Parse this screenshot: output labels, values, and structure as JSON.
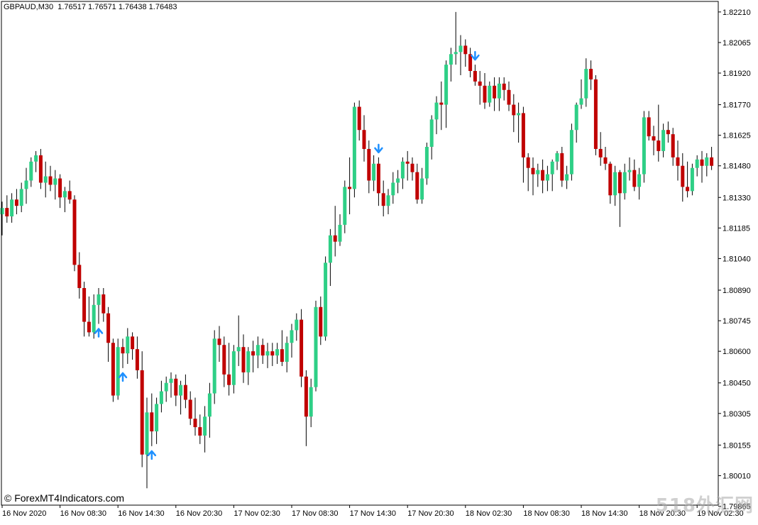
{
  "header": {
    "symbol": "GBPAUD,M30",
    "ohlc": "1.76517 1.76571 1.76438 1.76483"
  },
  "watermark": "© ForexMT4Indicators.com",
  "corner_watermark": "518外汇网",
  "colors": {
    "bull": "#2ecf86",
    "bear": "#c00000",
    "wick": "#000000",
    "arrow": "#1e90ff",
    "background": "#ffffff",
    "axis": "#000000"
  },
  "chart_data": {
    "type": "candlestick",
    "title": "",
    "xlabel": "",
    "ylabel": "",
    "ylim": [
      1.7987,
      1.8226
    ],
    "y_ticks": [
      "1.82210",
      "1.82065",
      "1.81920",
      "1.81770",
      "1.81625",
      "1.81480",
      "1.81330",
      "1.81185",
      "1.81040",
      "1.80890",
      "1.80745",
      "1.80600",
      "1.80450",
      "1.80305",
      "1.80155",
      "1.80010",
      "1.79865"
    ],
    "x_ticks": [
      "16 Nov 2020",
      "16 Nov 08:30",
      "16 Nov 14:30",
      "16 Nov 20:30",
      "17 Nov 02:30",
      "17 Nov 08:30",
      "17 Nov 14:30",
      "17 Nov 20:30",
      "18 Nov 02:30",
      "18 Nov 08:30",
      "18 Nov 14:30",
      "18 Nov 20:30",
      "19 Nov 02:30"
    ],
    "x_tick_candle_index": [
      0,
      12,
      24,
      36,
      48,
      60,
      72,
      84,
      96,
      108,
      120,
      132,
      144
    ],
    "candles": [
      {
        "o": 1.8125,
        "h": 1.8131,
        "l": 1.8115,
        "c": 1.8128
      },
      {
        "o": 1.8128,
        "h": 1.8134,
        "l": 1.8121,
        "c": 1.8124
      },
      {
        "o": 1.8124,
        "h": 1.8135,
        "l": 1.8121,
        "c": 1.8132
      },
      {
        "o": 1.8132,
        "h": 1.8137,
        "l": 1.8125,
        "c": 1.8129
      },
      {
        "o": 1.8129,
        "h": 1.814,
        "l": 1.8126,
        "c": 1.8137
      },
      {
        "o": 1.8137,
        "h": 1.8147,
        "l": 1.813,
        "c": 1.8141
      },
      {
        "o": 1.8141,
        "h": 1.8152,
        "l": 1.8138,
        "c": 1.815
      },
      {
        "o": 1.815,
        "h": 1.8155,
        "l": 1.8145,
        "c": 1.8153
      },
      {
        "o": 1.8153,
        "h": 1.8156,
        "l": 1.8137,
        "c": 1.814
      },
      {
        "o": 1.814,
        "h": 1.815,
        "l": 1.8133,
        "c": 1.8143
      },
      {
        "o": 1.8143,
        "h": 1.8148,
        "l": 1.8136,
        "c": 1.8139
      },
      {
        "o": 1.8139,
        "h": 1.8146,
        "l": 1.8132,
        "c": 1.8142
      },
      {
        "o": 1.8142,
        "h": 1.8144,
        "l": 1.8128,
        "c": 1.8133
      },
      {
        "o": 1.8133,
        "h": 1.8138,
        "l": 1.8126,
        "c": 1.8136
      },
      {
        "o": 1.8136,
        "h": 1.8141,
        "l": 1.813,
        "c": 1.8132
      },
      {
        "o": 1.8132,
        "h": 1.8134,
        "l": 1.8098,
        "c": 1.8101
      },
      {
        "o": 1.8101,
        "h": 1.8107,
        "l": 1.8085,
        "c": 1.809
      },
      {
        "o": 1.809,
        "h": 1.8093,
        "l": 1.8067,
        "c": 1.8074
      },
      {
        "o": 1.8074,
        "h": 1.8086,
        "l": 1.8067,
        "c": 1.8069
      },
      {
        "o": 1.8069,
        "h": 1.8087,
        "l": 1.8066,
        "c": 1.8082
      },
      {
        "o": 1.8082,
        "h": 1.809,
        "l": 1.8073,
        "c": 1.8087
      },
      {
        "o": 1.8087,
        "h": 1.809,
        "l": 1.8074,
        "c": 1.8078
      },
      {
        "o": 1.8078,
        "h": 1.8081,
        "l": 1.8055,
        "c": 1.8064
      },
      {
        "o": 1.8064,
        "h": 1.8066,
        "l": 1.8036,
        "c": 1.8039
      },
      {
        "o": 1.8039,
        "h": 1.8066,
        "l": 1.8037,
        "c": 1.8062
      },
      {
        "o": 1.8062,
        "h": 1.8066,
        "l": 1.8052,
        "c": 1.8059
      },
      {
        "o": 1.8059,
        "h": 1.8071,
        "l": 1.8054,
        "c": 1.8067
      },
      {
        "o": 1.8067,
        "h": 1.8069,
        "l": 1.8056,
        "c": 1.8061
      },
      {
        "o": 1.8061,
        "h": 1.8067,
        "l": 1.8047,
        "c": 1.8051
      },
      {
        "o": 1.8051,
        "h": 1.806,
        "l": 1.8005,
        "c": 1.8011
      },
      {
        "o": 1.8011,
        "h": 1.8038,
        "l": 1.7995,
        "c": 1.8031
      },
      {
        "o": 1.8031,
        "h": 1.804,
        "l": 1.8015,
        "c": 1.8022
      },
      {
        "o": 1.8022,
        "h": 1.8038,
        "l": 1.8016,
        "c": 1.8035
      },
      {
        "o": 1.8035,
        "h": 1.8046,
        "l": 1.8031,
        "c": 1.8041
      },
      {
        "o": 1.8041,
        "h": 1.8048,
        "l": 1.8036,
        "c": 1.8045
      },
      {
        "o": 1.8045,
        "h": 1.805,
        "l": 1.8038,
        "c": 1.8047
      },
      {
        "o": 1.8047,
        "h": 1.8049,
        "l": 1.8034,
        "c": 1.8039
      },
      {
        "o": 1.8039,
        "h": 1.8046,
        "l": 1.803,
        "c": 1.8044
      },
      {
        "o": 1.8044,
        "h": 1.8049,
        "l": 1.8033,
        "c": 1.8037
      },
      {
        "o": 1.8037,
        "h": 1.8041,
        "l": 1.8025,
        "c": 1.8028
      },
      {
        "o": 1.8028,
        "h": 1.8038,
        "l": 1.802,
        "c": 1.8024
      },
      {
        "o": 1.8024,
        "h": 1.803,
        "l": 1.8016,
        "c": 1.802
      },
      {
        "o": 1.802,
        "h": 1.8034,
        "l": 1.8012,
        "c": 1.8029
      },
      {
        "o": 1.8029,
        "h": 1.8045,
        "l": 1.8019,
        "c": 1.804
      },
      {
        "o": 1.804,
        "h": 1.807,
        "l": 1.8035,
        "c": 1.8066
      },
      {
        "o": 1.8066,
        "h": 1.8072,
        "l": 1.8055,
        "c": 1.8063
      },
      {
        "o": 1.8063,
        "h": 1.8067,
        "l": 1.8043,
        "c": 1.8049
      },
      {
        "o": 1.8049,
        "h": 1.8064,
        "l": 1.8039,
        "c": 1.8044
      },
      {
        "o": 1.8044,
        "h": 1.8063,
        "l": 1.804,
        "c": 1.806
      },
      {
        "o": 1.806,
        "h": 1.8077,
        "l": 1.8053,
        "c": 1.8062
      },
      {
        "o": 1.8062,
        "h": 1.8068,
        "l": 1.8045,
        "c": 1.805
      },
      {
        "o": 1.805,
        "h": 1.8062,
        "l": 1.8044,
        "c": 1.806
      },
      {
        "o": 1.806,
        "h": 1.8065,
        "l": 1.805,
        "c": 1.8058
      },
      {
        "o": 1.8058,
        "h": 1.8067,
        "l": 1.8052,
        "c": 1.8063
      },
      {
        "o": 1.8063,
        "h": 1.8066,
        "l": 1.8054,
        "c": 1.8058
      },
      {
        "o": 1.8058,
        "h": 1.8064,
        "l": 1.8052,
        "c": 1.806
      },
      {
        "o": 1.806,
        "h": 1.8064,
        "l": 1.8053,
        "c": 1.8058
      },
      {
        "o": 1.8058,
        "h": 1.8064,
        "l": 1.8054,
        "c": 1.8061
      },
      {
        "o": 1.8061,
        "h": 1.807,
        "l": 1.8053,
        "c": 1.8055
      },
      {
        "o": 1.8055,
        "h": 1.8067,
        "l": 1.805,
        "c": 1.8064
      },
      {
        "o": 1.8064,
        "h": 1.8073,
        "l": 1.8057,
        "c": 1.807
      },
      {
        "o": 1.807,
        "h": 1.8078,
        "l": 1.8065,
        "c": 1.8075
      },
      {
        "o": 1.8075,
        "h": 1.808,
        "l": 1.8043,
        "c": 1.8048
      },
      {
        "o": 1.8048,
        "h": 1.8051,
        "l": 1.8015,
        "c": 1.8029
      },
      {
        "o": 1.8029,
        "h": 1.8047,
        "l": 1.8024,
        "c": 1.8043
      },
      {
        "o": 1.8043,
        "h": 1.8084,
        "l": 1.8041,
        "c": 1.8081
      },
      {
        "o": 1.8081,
        "h": 1.8086,
        "l": 1.8063,
        "c": 1.8067
      },
      {
        "o": 1.8067,
        "h": 1.8105,
        "l": 1.8065,
        "c": 1.8102
      },
      {
        "o": 1.8102,
        "h": 1.8118,
        "l": 1.8091,
        "c": 1.8115
      },
      {
        "o": 1.8115,
        "h": 1.8129,
        "l": 1.8105,
        "c": 1.8112
      },
      {
        "o": 1.8112,
        "h": 1.8125,
        "l": 1.811,
        "c": 1.812
      },
      {
        "o": 1.812,
        "h": 1.8141,
        "l": 1.8116,
        "c": 1.8138
      },
      {
        "o": 1.8138,
        "h": 1.8152,
        "l": 1.8125,
        "c": 1.8137
      },
      {
        "o": 1.8137,
        "h": 1.8178,
        "l": 1.8133,
        "c": 1.8176
      },
      {
        "o": 1.8176,
        "h": 1.8179,
        "l": 1.816,
        "c": 1.8165
      },
      {
        "o": 1.8165,
        "h": 1.8172,
        "l": 1.815,
        "c": 1.8156
      },
      {
        "o": 1.8156,
        "h": 1.816,
        "l": 1.8135,
        "c": 1.8141
      },
      {
        "o": 1.8141,
        "h": 1.8153,
        "l": 1.8136,
        "c": 1.8149
      },
      {
        "o": 1.8149,
        "h": 1.8152,
        "l": 1.8129,
        "c": 1.8135
      },
      {
        "o": 1.8135,
        "h": 1.8141,
        "l": 1.8124,
        "c": 1.8129
      },
      {
        "o": 1.8129,
        "h": 1.8137,
        "l": 1.8125,
        "c": 1.8134
      },
      {
        "o": 1.8134,
        "h": 1.8145,
        "l": 1.813,
        "c": 1.814
      },
      {
        "o": 1.814,
        "h": 1.8146,
        "l": 1.8135,
        "c": 1.8142
      },
      {
        "o": 1.8142,
        "h": 1.8152,
        "l": 1.8137,
        "c": 1.815
      },
      {
        "o": 1.815,
        "h": 1.8155,
        "l": 1.8141,
        "c": 1.8149
      },
      {
        "o": 1.8149,
        "h": 1.8152,
        "l": 1.8141,
        "c": 1.8145
      },
      {
        "o": 1.8145,
        "h": 1.8149,
        "l": 1.813,
        "c": 1.8132
      },
      {
        "o": 1.8132,
        "h": 1.8147,
        "l": 1.813,
        "c": 1.8142
      },
      {
        "o": 1.8142,
        "h": 1.8159,
        "l": 1.8139,
        "c": 1.8157
      },
      {
        "o": 1.8157,
        "h": 1.8172,
        "l": 1.8151,
        "c": 1.817
      },
      {
        "o": 1.817,
        "h": 1.8181,
        "l": 1.8163,
        "c": 1.8178
      },
      {
        "o": 1.8178,
        "h": 1.8188,
        "l": 1.8165,
        "c": 1.8177
      },
      {
        "o": 1.8177,
        "h": 1.8198,
        "l": 1.8166,
        "c": 1.8196
      },
      {
        "o": 1.8196,
        "h": 1.8204,
        "l": 1.8188,
        "c": 1.8201
      },
      {
        "o": 1.8201,
        "h": 1.8221,
        "l": 1.8196,
        "c": 1.8202
      },
      {
        "o": 1.8202,
        "h": 1.821,
        "l": 1.8191,
        "c": 1.8205
      },
      {
        "o": 1.8205,
        "h": 1.8208,
        "l": 1.8195,
        "c": 1.8201
      },
      {
        "o": 1.8201,
        "h": 1.8204,
        "l": 1.819,
        "c": 1.8193
      },
      {
        "o": 1.8193,
        "h": 1.8196,
        "l": 1.8186,
        "c": 1.8188
      },
      {
        "o": 1.8188,
        "h": 1.8193,
        "l": 1.8177,
        "c": 1.8186
      },
      {
        "o": 1.8186,
        "h": 1.8192,
        "l": 1.8175,
        "c": 1.8178
      },
      {
        "o": 1.8178,
        "h": 1.8188,
        "l": 1.8176,
        "c": 1.8186
      },
      {
        "o": 1.8186,
        "h": 1.819,
        "l": 1.8174,
        "c": 1.818
      },
      {
        "o": 1.818,
        "h": 1.819,
        "l": 1.8174,
        "c": 1.8187
      },
      {
        "o": 1.8187,
        "h": 1.819,
        "l": 1.8179,
        "c": 1.8184
      },
      {
        "o": 1.8184,
        "h": 1.8188,
        "l": 1.8174,
        "c": 1.8177
      },
      {
        "o": 1.8177,
        "h": 1.8182,
        "l": 1.8164,
        "c": 1.8172
      },
      {
        "o": 1.8172,
        "h": 1.8178,
        "l": 1.8159,
        "c": 1.8173
      },
      {
        "o": 1.8173,
        "h": 1.8176,
        "l": 1.814,
        "c": 1.8152
      },
      {
        "o": 1.8152,
        "h": 1.8154,
        "l": 1.8136,
        "c": 1.8147
      },
      {
        "o": 1.8147,
        "h": 1.8152,
        "l": 1.8134,
        "c": 1.8144
      },
      {
        "o": 1.8144,
        "h": 1.8149,
        "l": 1.8138,
        "c": 1.8146
      },
      {
        "o": 1.8146,
        "h": 1.8151,
        "l": 1.8135,
        "c": 1.8141
      },
      {
        "o": 1.8141,
        "h": 1.8148,
        "l": 1.8136,
        "c": 1.8144
      },
      {
        "o": 1.8144,
        "h": 1.8151,
        "l": 1.8136,
        "c": 1.815
      },
      {
        "o": 1.815,
        "h": 1.8155,
        "l": 1.8146,
        "c": 1.8154
      },
      {
        "o": 1.8154,
        "h": 1.8157,
        "l": 1.8138,
        "c": 1.8141
      },
      {
        "o": 1.8141,
        "h": 1.8148,
        "l": 1.8137,
        "c": 1.8144
      },
      {
        "o": 1.8144,
        "h": 1.8168,
        "l": 1.8141,
        "c": 1.8165
      },
      {
        "o": 1.8165,
        "h": 1.8178,
        "l": 1.8159,
        "c": 1.8177
      },
      {
        "o": 1.8177,
        "h": 1.8189,
        "l": 1.8175,
        "c": 1.818
      },
      {
        "o": 1.818,
        "h": 1.8199,
        "l": 1.8176,
        "c": 1.8194
      },
      {
        "o": 1.8194,
        "h": 1.8198,
        "l": 1.8184,
        "c": 1.8189
      },
      {
        "o": 1.8189,
        "h": 1.8191,
        "l": 1.8153,
        "c": 1.8156
      },
      {
        "o": 1.8156,
        "h": 1.8164,
        "l": 1.8148,
        "c": 1.8152
      },
      {
        "o": 1.8152,
        "h": 1.8157,
        "l": 1.8146,
        "c": 1.8149
      },
      {
        "o": 1.8149,
        "h": 1.815,
        "l": 1.813,
        "c": 1.8134
      },
      {
        "o": 1.8134,
        "h": 1.8148,
        "l": 1.8129,
        "c": 1.8145
      },
      {
        "o": 1.8145,
        "h": 1.8146,
        "l": 1.8119,
        "c": 1.8135
      },
      {
        "o": 1.8135,
        "h": 1.8149,
        "l": 1.8132,
        "c": 1.8145
      },
      {
        "o": 1.8145,
        "h": 1.8152,
        "l": 1.8141,
        "c": 1.8146
      },
      {
        "o": 1.8146,
        "h": 1.8151,
        "l": 1.8136,
        "c": 1.8138
      },
      {
        "o": 1.8138,
        "h": 1.8147,
        "l": 1.8132,
        "c": 1.8144
      },
      {
        "o": 1.8144,
        "h": 1.8174,
        "l": 1.814,
        "c": 1.8171
      },
      {
        "o": 1.8171,
        "h": 1.8174,
        "l": 1.816,
        "c": 1.8162
      },
      {
        "o": 1.8162,
        "h": 1.8167,
        "l": 1.8153,
        "c": 1.816
      },
      {
        "o": 1.816,
        "h": 1.8177,
        "l": 1.815,
        "c": 1.8155
      },
      {
        "o": 1.8155,
        "h": 1.8168,
        "l": 1.8152,
        "c": 1.8165
      },
      {
        "o": 1.8165,
        "h": 1.8169,
        "l": 1.8159,
        "c": 1.8163
      },
      {
        "o": 1.8163,
        "h": 1.8166,
        "l": 1.8148,
        "c": 1.8152
      },
      {
        "o": 1.8152,
        "h": 1.816,
        "l": 1.8141,
        "c": 1.8148
      },
      {
        "o": 1.8148,
        "h": 1.8154,
        "l": 1.8131,
        "c": 1.8138
      },
      {
        "o": 1.8138,
        "h": 1.815,
        "l": 1.8133,
        "c": 1.8136
      },
      {
        "o": 1.8136,
        "h": 1.8149,
        "l": 1.8134,
        "c": 1.8147
      },
      {
        "o": 1.8147,
        "h": 1.8153,
        "l": 1.8143,
        "c": 1.8151
      },
      {
        "o": 1.8151,
        "h": 1.8155,
        "l": 1.814,
        "c": 1.8148
      },
      {
        "o": 1.8148,
        "h": 1.8154,
        "l": 1.8143,
        "c": 1.8152
      },
      {
        "o": 1.8152,
        "h": 1.8157,
        "l": 1.8146,
        "c": 1.8148
      }
    ],
    "signals": [
      {
        "index": 20,
        "dir": "up",
        "price": 1.8069
      },
      {
        "index": 25,
        "dir": "up",
        "price": 1.8039
      },
      {
        "index": 31,
        "dir": "up",
        "price": 1.8011
      },
      {
        "index": 78,
        "dir": "down",
        "price": 1.8176
      },
      {
        "index": 98,
        "dir": "down",
        "price": 1.8201
      }
    ]
  }
}
